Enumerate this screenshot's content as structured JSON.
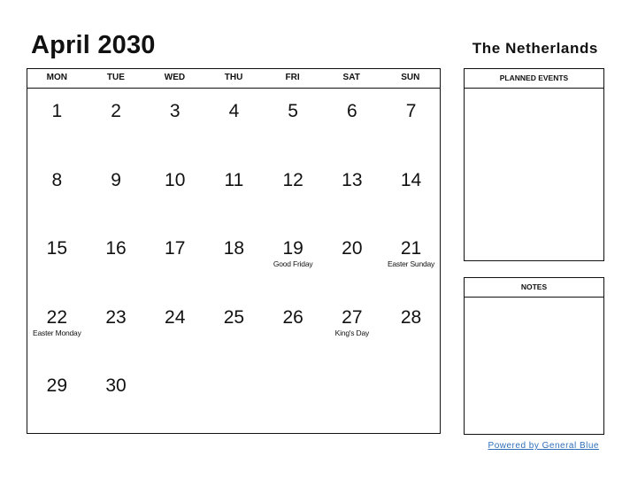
{
  "header": {
    "title": "April 2030",
    "country": "The Netherlands"
  },
  "calendar": {
    "weekdays": [
      "MON",
      "TUE",
      "WED",
      "THU",
      "FRI",
      "SAT",
      "SUN"
    ],
    "weeks": [
      [
        {
          "day": "1",
          "holiday": ""
        },
        {
          "day": "2",
          "holiday": ""
        },
        {
          "day": "3",
          "holiday": ""
        },
        {
          "day": "4",
          "holiday": ""
        },
        {
          "day": "5",
          "holiday": ""
        },
        {
          "day": "6",
          "holiday": ""
        },
        {
          "day": "7",
          "holiday": ""
        }
      ],
      [
        {
          "day": "8",
          "holiday": ""
        },
        {
          "day": "9",
          "holiday": ""
        },
        {
          "day": "10",
          "holiday": ""
        },
        {
          "day": "11",
          "holiday": ""
        },
        {
          "day": "12",
          "holiday": ""
        },
        {
          "day": "13",
          "holiday": ""
        },
        {
          "day": "14",
          "holiday": ""
        }
      ],
      [
        {
          "day": "15",
          "holiday": ""
        },
        {
          "day": "16",
          "holiday": ""
        },
        {
          "day": "17",
          "holiday": ""
        },
        {
          "day": "18",
          "holiday": ""
        },
        {
          "day": "19",
          "holiday": "Good Friday"
        },
        {
          "day": "20",
          "holiday": ""
        },
        {
          "day": "21",
          "holiday": "Easter Sunday"
        }
      ],
      [
        {
          "day": "22",
          "holiday": "Easter Monday"
        },
        {
          "day": "23",
          "holiday": ""
        },
        {
          "day": "24",
          "holiday": ""
        },
        {
          "day": "25",
          "holiday": ""
        },
        {
          "day": "26",
          "holiday": ""
        },
        {
          "day": "27",
          "holiday": "King's Day"
        },
        {
          "day": "28",
          "holiday": ""
        }
      ],
      [
        {
          "day": "29",
          "holiday": ""
        },
        {
          "day": "30",
          "holiday": ""
        },
        {
          "day": "",
          "holiday": ""
        },
        {
          "day": "",
          "holiday": ""
        },
        {
          "day": "",
          "holiday": ""
        },
        {
          "day": "",
          "holiday": ""
        },
        {
          "day": "",
          "holiday": ""
        }
      ]
    ]
  },
  "sidebar": {
    "planned_events_label": "PLANNED EVENTS",
    "notes_label": "NOTES"
  },
  "footer": {
    "powered_by": "Powered by General Blue",
    "link_color": "#2f6fba"
  }
}
